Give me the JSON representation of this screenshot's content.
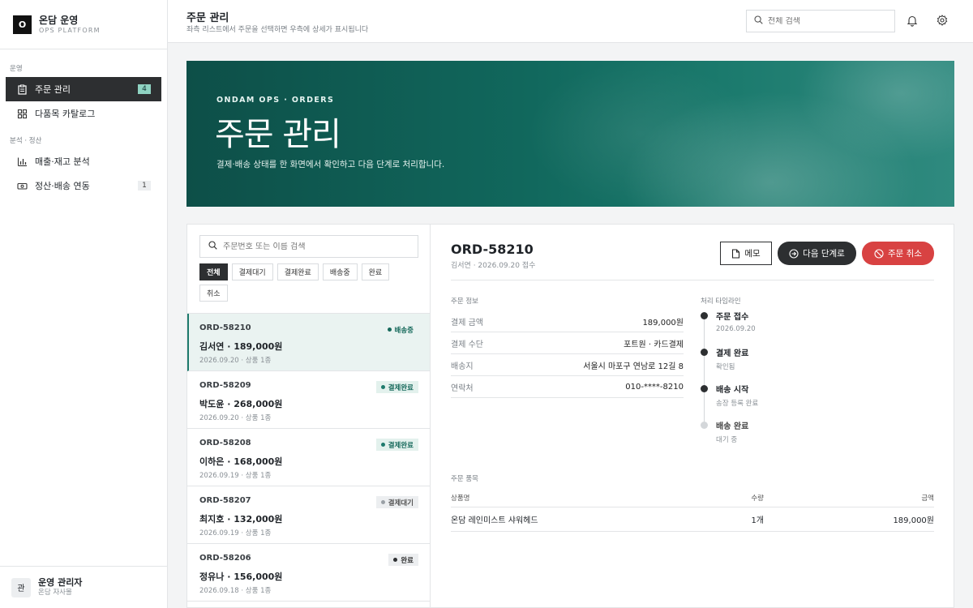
{
  "brand": {
    "logo": "O",
    "name": "온담 운영",
    "sub": "OPS PLATFORM"
  },
  "sidebar": {
    "section1": "운영",
    "section2": "분석 · 정산",
    "items": [
      {
        "label": "주문 관리",
        "count": "4",
        "icon": "clipboard-icon"
      },
      {
        "label": "다품목 카탈로그",
        "count": "",
        "icon": "grid-icon"
      },
      {
        "label": "매출·재고 분석",
        "count": "",
        "icon": "bar-chart-icon"
      },
      {
        "label": "정산·배송 연동",
        "count": "1",
        "icon": "money-icon"
      }
    ]
  },
  "profile": {
    "initial": "관",
    "name": "운영 관리자",
    "sub": "온담 자사몰"
  },
  "topbar": {
    "title": "주문 관리",
    "subtitle": "좌측 리스트에서 주문을 선택하면 우측에 상세가 표시됩니다",
    "search_placeholder": "전체 검색"
  },
  "hero": {
    "eyebrow": "ONDAM OPS · ORDERS",
    "title": "주문 관리",
    "subtitle": "결제·배송 상태를 한 화면에서 확인하고 다음 단계로 처리합니다."
  },
  "list": {
    "search_placeholder": "주문번호 또는 이름 검색",
    "filters": [
      "전체",
      "결제대기",
      "결제완료",
      "배송중",
      "완료",
      "취소"
    ],
    "orders": [
      {
        "id": "ORD-58210",
        "name": "김서연 · 189,000원",
        "meta": "2026.09.20 · 상품 1종",
        "status": "배송중"
      },
      {
        "id": "ORD-58209",
        "name": "박도윤 · 268,000원",
        "meta": "2026.09.20 · 상품 1종",
        "status": "결제완료"
      },
      {
        "id": "ORD-58208",
        "name": "이하은 · 168,000원",
        "meta": "2026.09.19 · 상품 1종",
        "status": "결제완료"
      },
      {
        "id": "ORD-58207",
        "name": "최지호 · 132,000원",
        "meta": "2026.09.19 · 상품 1종",
        "status": "결제대기"
      },
      {
        "id": "ORD-58206",
        "name": "정유나 · 156,000원",
        "meta": "2026.09.18 · 상품 1종",
        "status": "완료"
      }
    ]
  },
  "detail": {
    "title": "ORD-58210",
    "subtitle": "김서연 · 2026.09.20 접수",
    "btn_memo": "메모",
    "btn_next": "다음 단계로",
    "btn_cancel": "주문 취소",
    "info_label": "주문 정보",
    "info": [
      {
        "k": "결제 금액",
        "v": "189,000원"
      },
      {
        "k": "결제 수단",
        "v": "포트원 · 카드결제"
      },
      {
        "k": "배송지",
        "v": "서울시 마포구 연남로 12길 8"
      },
      {
        "k": "연락처",
        "v": "010-****-8210"
      }
    ],
    "timeline_label": "처리 타임라인",
    "timeline": [
      {
        "title": "주문 접수",
        "sub": "2026.09.20",
        "done": true
      },
      {
        "title": "결제 완료",
        "sub": "확인됨",
        "done": true
      },
      {
        "title": "배송 시작",
        "sub": "송장 등록 완료",
        "done": true
      },
      {
        "title": "배송 완료",
        "sub": "대기 중",
        "done": false
      }
    ],
    "items_label": "주문 품목",
    "items_head": {
      "name": "상품명",
      "qty": "수량",
      "amount": "금액"
    },
    "items": [
      {
        "name": "온담 레인미스트 샤워헤드",
        "qty": "1개",
        "amount": "189,000원"
      }
    ]
  },
  "colors": {
    "accent": "#1e7a6c",
    "danger": "#d84242",
    "dark": "#2d2f31"
  }
}
